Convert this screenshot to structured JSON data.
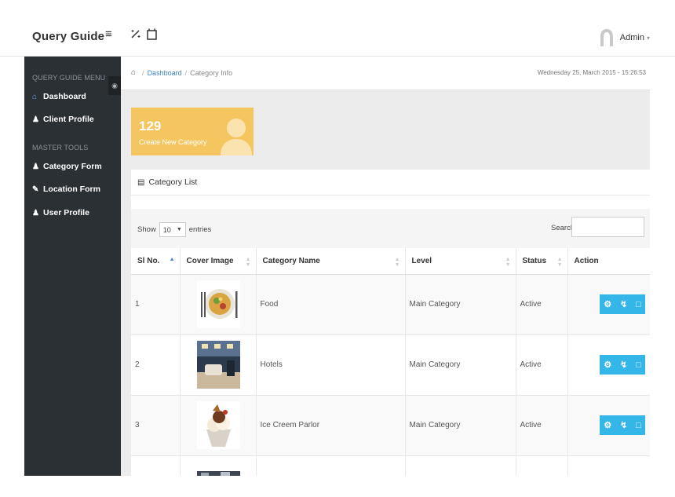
{
  "app": {
    "brand": "Query Guide"
  },
  "topbar": {
    "menu_icon": "hamburger-icon",
    "tools_icon": "magic-wand-icon",
    "window_icon": "window-icon",
    "admin_label": "Admin",
    "avatar_icon": "user-silhouette-icon"
  },
  "sidebar": {
    "menu_heading": "QUERY GUIDE MENU",
    "menu_items": [
      {
        "label": "Dashboard",
        "icon": "home-icon"
      },
      {
        "label": "Client Profile",
        "icon": "users-icon"
      }
    ],
    "tools_heading": "MASTER TOOLS",
    "tool_items": [
      {
        "label": "Category Form",
        "icon": "group-icon"
      },
      {
        "label": "Location Form",
        "icon": "pencil-icon"
      },
      {
        "label": "User Profile",
        "icon": "user-icon"
      }
    ]
  },
  "breadcrumb": {
    "home_icon": "home-icon",
    "separator": "/",
    "dashboard": "Dashboard",
    "current": "Category Info"
  },
  "datetime": "Wednesday 25, March 2015 - 15:26:53",
  "tile": {
    "count": "129",
    "label": "Create New Category",
    "color": "#f5c560"
  },
  "panel": {
    "title": "Category List",
    "show_label": "Show",
    "entries_value": "10",
    "entries_label": "entries",
    "search_label": "Search:"
  },
  "table": {
    "columns": [
      "Sl No.",
      "Cover Image",
      "Category Name",
      "Level",
      "Status",
      "Action"
    ],
    "rows": [
      {
        "no": "1",
        "image": "food-plate-image",
        "name": "Food",
        "level": "Main Category",
        "status": "Active"
      },
      {
        "no": "2",
        "image": "hotel-lobby-image",
        "name": "Hotels",
        "level": "Main Category",
        "status": "Active"
      },
      {
        "no": "3",
        "image": "ice-cream-image",
        "name": "Ice Creem Parlor",
        "level": "Main Category",
        "status": "Active"
      }
    ]
  },
  "colors": {
    "sidebar_bg": "#2b3035",
    "accent_blue": "#35b6e8",
    "link_blue": "#3c83c4",
    "tile_yellow": "#f5c560"
  }
}
